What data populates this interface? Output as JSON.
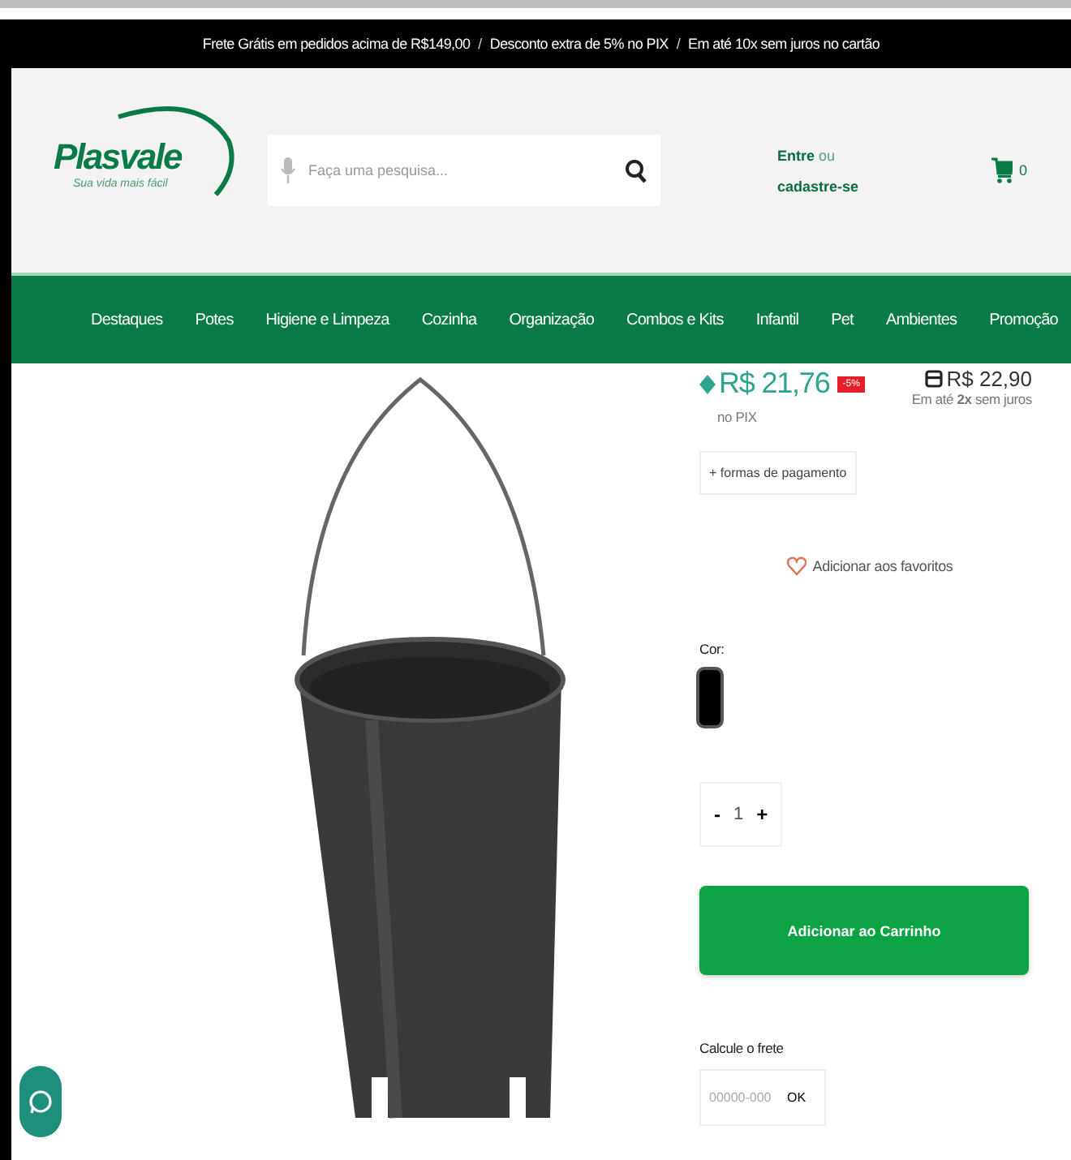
{
  "announcement": {
    "parts": [
      "Frete Grátis em pedidos acima de R$149,00",
      "Desconto extra de 5% no PIX",
      "Em até 10x sem juros no cartão"
    ],
    "separator": "/"
  },
  "header": {
    "logo": {
      "name": "Plasvale",
      "tagline": "Sua vida mais fácil"
    },
    "search": {
      "placeholder": "Faça uma pesquisa..."
    },
    "account": {
      "login": "Entre",
      "or": "ou",
      "register": "cadastre-se"
    },
    "cart": {
      "count": "0"
    }
  },
  "nav": [
    "Destaques",
    "Potes",
    "Higiene e Limpeza",
    "Cozinha",
    "Organização",
    "Combos e Kits",
    "Infantil",
    "Pet",
    "Ambientes",
    "Promoção"
  ],
  "product": {
    "pix_price": "R$ 21,76",
    "discount_badge": "-5%",
    "pix_label": "no PIX",
    "card_price": "R$ 22,90",
    "installments": "Em até **2x** sem juros",
    "payment_button": "+ formas de pagamento",
    "favorite": "Adicionar aos favoritos",
    "color_label": "Cor:",
    "colors": [
      {
        "color": "#000000",
        "selected": true
      }
    ],
    "quantity": {
      "minus": "-",
      "value": "1",
      "plus": "+"
    },
    "add_to_cart": "Adicionar ao Carrinho",
    "shipping": {
      "label": "Calcule o frete",
      "placeholder": "00000-000",
      "button": "OK"
    }
  }
}
